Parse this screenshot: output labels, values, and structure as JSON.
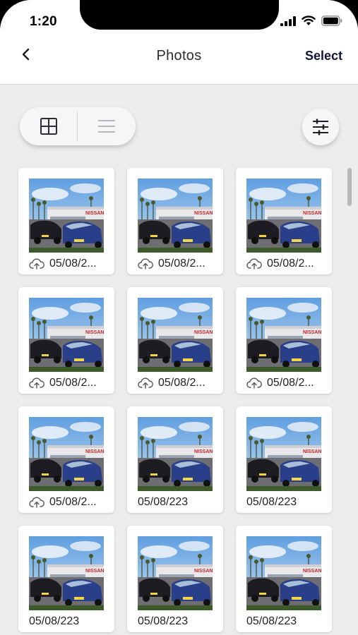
{
  "status_bar": {
    "time": "1:20"
  },
  "nav": {
    "title": "Photos",
    "select_label": "Select"
  },
  "view_toggle": {
    "grid_icon": "grid-icon",
    "list_icon": "list-icon",
    "active": "grid"
  },
  "filter": {
    "icon": "sliders-icon"
  },
  "photos": [
    {
      "date": "05/08/2...",
      "uploaded": true
    },
    {
      "date": "05/08/2...",
      "uploaded": true
    },
    {
      "date": "05/08/2...",
      "uploaded": true
    },
    {
      "date": "05/08/2...",
      "uploaded": true
    },
    {
      "date": "05/08/2...",
      "uploaded": true
    },
    {
      "date": "05/08/2...",
      "uploaded": true
    },
    {
      "date": "05/08/2...",
      "uploaded": true
    },
    {
      "date": "05/08/223",
      "uploaded": false
    },
    {
      "date": "05/08/223",
      "uploaded": false
    },
    {
      "date": "05/08/223",
      "uploaded": false
    },
    {
      "date": "05/08/223",
      "uploaded": false
    },
    {
      "date": "05/08/223",
      "uploaded": false
    }
  ],
  "photo_sign": "NISSAN"
}
